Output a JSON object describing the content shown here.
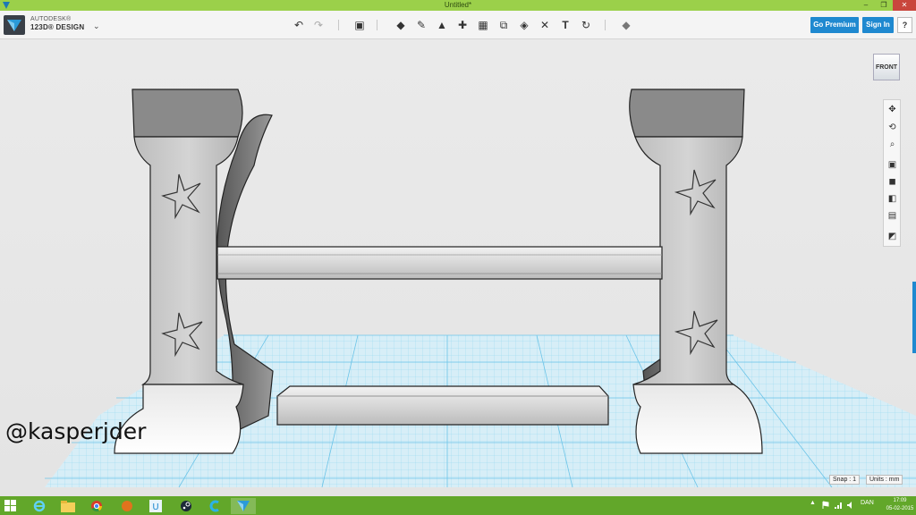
{
  "window": {
    "title": "Untitled*",
    "minimize_glyph": "–",
    "restore_glyph": "❐",
    "close_glyph": "✕"
  },
  "toolbar": {
    "brand_line1": "AUTODESK®",
    "brand_line2": "123D® DESIGN",
    "menu_chevron": "⌄",
    "undo_glyph": "↶",
    "redo_glyph": "↷",
    "tools": [
      {
        "name": "transform-icon",
        "glyph": "▣"
      },
      {
        "name": "primitives-icon",
        "glyph": "◆"
      },
      {
        "name": "sketch-icon",
        "glyph": "✎"
      },
      {
        "name": "construct-icon",
        "glyph": "▲"
      },
      {
        "name": "modify-icon",
        "glyph": "✚"
      },
      {
        "name": "pattern-icon",
        "glyph": "▦"
      },
      {
        "name": "group-icon",
        "glyph": "⧉"
      },
      {
        "name": "combine-icon",
        "glyph": "◈"
      },
      {
        "name": "measure-icon",
        "glyph": "✕"
      },
      {
        "name": "text-icon",
        "glyph": "T"
      },
      {
        "name": "snap-icon",
        "glyph": "↻"
      },
      {
        "name": "material-icon",
        "glyph": "◆"
      }
    ],
    "go_premium": "Go Premium",
    "sign_in": "Sign In",
    "help": "?"
  },
  "viewport": {
    "view_cube_label": "FRONT",
    "nav_tools": [
      {
        "name": "pan-icon",
        "glyph": "✥"
      },
      {
        "name": "orbit-icon",
        "glyph": "⟲"
      },
      {
        "name": "zoom-icon",
        "glyph": "⌕"
      },
      {
        "name": "fit-icon",
        "glyph": "▣"
      },
      {
        "name": "view-solid-icon",
        "glyph": "◼"
      },
      {
        "name": "view-outline-icon",
        "glyph": "◧"
      },
      {
        "name": "grid-icon",
        "glyph": "▤"
      },
      {
        "name": "material-view-icon",
        "glyph": "◩"
      }
    ],
    "watermark": "@kasperjder"
  },
  "status": {
    "snap": "Snap : 1",
    "units": "Units : mm"
  },
  "taskbar": {
    "tray_arrow": "▲",
    "language": "DAN",
    "time": "17:09",
    "date": "05-02-2015"
  },
  "colors": {
    "accent": "#1f89d0",
    "titlebar": "#9bd04a",
    "taskbar": "#62a72a",
    "grid": "#6cc4e8"
  }
}
